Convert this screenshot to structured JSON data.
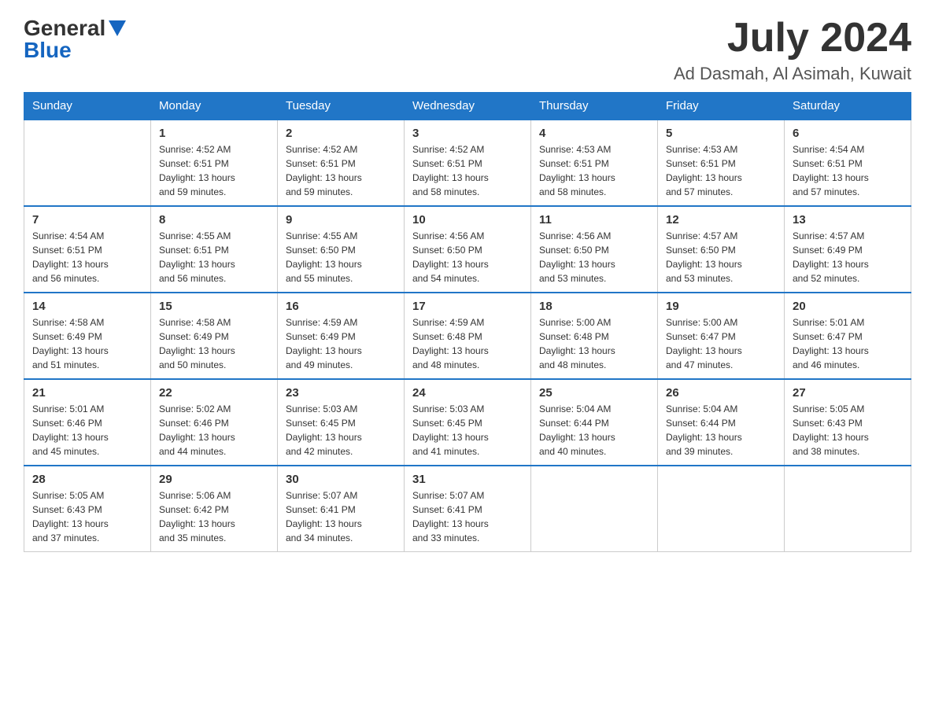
{
  "header": {
    "month_title": "July 2024",
    "location": "Ad Dasmah, Al Asimah, Kuwait",
    "logo_general": "General",
    "logo_blue": "Blue"
  },
  "weekdays": [
    "Sunday",
    "Monday",
    "Tuesday",
    "Wednesday",
    "Thursday",
    "Friday",
    "Saturday"
  ],
  "weeks": [
    [
      {
        "day": "",
        "info": ""
      },
      {
        "day": "1",
        "info": "Sunrise: 4:52 AM\nSunset: 6:51 PM\nDaylight: 13 hours\nand 59 minutes."
      },
      {
        "day": "2",
        "info": "Sunrise: 4:52 AM\nSunset: 6:51 PM\nDaylight: 13 hours\nand 59 minutes."
      },
      {
        "day": "3",
        "info": "Sunrise: 4:52 AM\nSunset: 6:51 PM\nDaylight: 13 hours\nand 58 minutes."
      },
      {
        "day": "4",
        "info": "Sunrise: 4:53 AM\nSunset: 6:51 PM\nDaylight: 13 hours\nand 58 minutes."
      },
      {
        "day": "5",
        "info": "Sunrise: 4:53 AM\nSunset: 6:51 PM\nDaylight: 13 hours\nand 57 minutes."
      },
      {
        "day": "6",
        "info": "Sunrise: 4:54 AM\nSunset: 6:51 PM\nDaylight: 13 hours\nand 57 minutes."
      }
    ],
    [
      {
        "day": "7",
        "info": "Sunrise: 4:54 AM\nSunset: 6:51 PM\nDaylight: 13 hours\nand 56 minutes."
      },
      {
        "day": "8",
        "info": "Sunrise: 4:55 AM\nSunset: 6:51 PM\nDaylight: 13 hours\nand 56 minutes."
      },
      {
        "day": "9",
        "info": "Sunrise: 4:55 AM\nSunset: 6:50 PM\nDaylight: 13 hours\nand 55 minutes."
      },
      {
        "day": "10",
        "info": "Sunrise: 4:56 AM\nSunset: 6:50 PM\nDaylight: 13 hours\nand 54 minutes."
      },
      {
        "day": "11",
        "info": "Sunrise: 4:56 AM\nSunset: 6:50 PM\nDaylight: 13 hours\nand 53 minutes."
      },
      {
        "day": "12",
        "info": "Sunrise: 4:57 AM\nSunset: 6:50 PM\nDaylight: 13 hours\nand 53 minutes."
      },
      {
        "day": "13",
        "info": "Sunrise: 4:57 AM\nSunset: 6:49 PM\nDaylight: 13 hours\nand 52 minutes."
      }
    ],
    [
      {
        "day": "14",
        "info": "Sunrise: 4:58 AM\nSunset: 6:49 PM\nDaylight: 13 hours\nand 51 minutes."
      },
      {
        "day": "15",
        "info": "Sunrise: 4:58 AM\nSunset: 6:49 PM\nDaylight: 13 hours\nand 50 minutes."
      },
      {
        "day": "16",
        "info": "Sunrise: 4:59 AM\nSunset: 6:49 PM\nDaylight: 13 hours\nand 49 minutes."
      },
      {
        "day": "17",
        "info": "Sunrise: 4:59 AM\nSunset: 6:48 PM\nDaylight: 13 hours\nand 48 minutes."
      },
      {
        "day": "18",
        "info": "Sunrise: 5:00 AM\nSunset: 6:48 PM\nDaylight: 13 hours\nand 48 minutes."
      },
      {
        "day": "19",
        "info": "Sunrise: 5:00 AM\nSunset: 6:47 PM\nDaylight: 13 hours\nand 47 minutes."
      },
      {
        "day": "20",
        "info": "Sunrise: 5:01 AM\nSunset: 6:47 PM\nDaylight: 13 hours\nand 46 minutes."
      }
    ],
    [
      {
        "day": "21",
        "info": "Sunrise: 5:01 AM\nSunset: 6:46 PM\nDaylight: 13 hours\nand 45 minutes."
      },
      {
        "day": "22",
        "info": "Sunrise: 5:02 AM\nSunset: 6:46 PM\nDaylight: 13 hours\nand 44 minutes."
      },
      {
        "day": "23",
        "info": "Sunrise: 5:03 AM\nSunset: 6:45 PM\nDaylight: 13 hours\nand 42 minutes."
      },
      {
        "day": "24",
        "info": "Sunrise: 5:03 AM\nSunset: 6:45 PM\nDaylight: 13 hours\nand 41 minutes."
      },
      {
        "day": "25",
        "info": "Sunrise: 5:04 AM\nSunset: 6:44 PM\nDaylight: 13 hours\nand 40 minutes."
      },
      {
        "day": "26",
        "info": "Sunrise: 5:04 AM\nSunset: 6:44 PM\nDaylight: 13 hours\nand 39 minutes."
      },
      {
        "day": "27",
        "info": "Sunrise: 5:05 AM\nSunset: 6:43 PM\nDaylight: 13 hours\nand 38 minutes."
      }
    ],
    [
      {
        "day": "28",
        "info": "Sunrise: 5:05 AM\nSunset: 6:43 PM\nDaylight: 13 hours\nand 37 minutes."
      },
      {
        "day": "29",
        "info": "Sunrise: 5:06 AM\nSunset: 6:42 PM\nDaylight: 13 hours\nand 35 minutes."
      },
      {
        "day": "30",
        "info": "Sunrise: 5:07 AM\nSunset: 6:41 PM\nDaylight: 13 hours\nand 34 minutes."
      },
      {
        "day": "31",
        "info": "Sunrise: 5:07 AM\nSunset: 6:41 PM\nDaylight: 13 hours\nand 33 minutes."
      },
      {
        "day": "",
        "info": ""
      },
      {
        "day": "",
        "info": ""
      },
      {
        "day": "",
        "info": ""
      }
    ]
  ]
}
